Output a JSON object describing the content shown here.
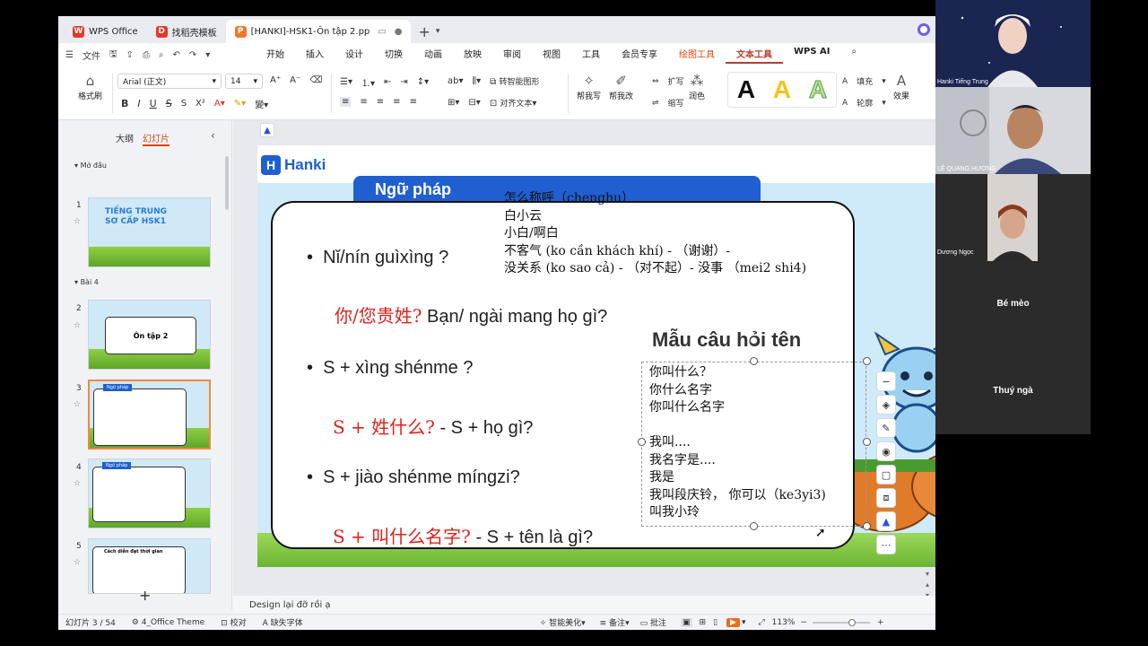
{
  "tabs": [
    {
      "label": "WPS Office",
      "icon": "wps-logo-icon",
      "color": "#e8362a"
    },
    {
      "label": "找稻壳模板",
      "icon": "docer-icon",
      "color": "#e8362a"
    },
    {
      "label": "[HANKI]-HSK1-Ôn tập 2.pp",
      "icon": "presentation-file-icon",
      "color": "#f0782a",
      "active": true
    }
  ],
  "menubar": {
    "file": "文件",
    "items": [
      "开始",
      "插入",
      "设计",
      "切换",
      "动画",
      "放映",
      "审阅",
      "视图",
      "工具",
      "会员专享",
      "绘图工具",
      "文本工具",
      "WPS AI"
    ]
  },
  "ribbon": {
    "format_painter": "格式刷",
    "font_name": "Arial (正文)",
    "font_size": "14",
    "smart_shape": "转智能图形",
    "align_text": "对齐文本",
    "help_write": "帮我写",
    "help_modify": "帮我改",
    "expand": "扩写",
    "shrink": "缩写",
    "polish": "润色",
    "fill": "填充",
    "outline": "轮廓",
    "effects": "效果",
    "wordart_glyph": "A"
  },
  "left_panel": {
    "tab_outline": "大纲",
    "tab_slides": "幻灯片",
    "section1": "Mở đầu",
    "section2": "Bài 4",
    "slide1_title": "TIẾNG TRUNG SƠ CẤP HSK1",
    "slide2_title": "Ôn tập 2",
    "slide3_title": "Ngữ pháp",
    "slide4_title": "Ngữ pháp",
    "slide5_title": "Cách diễn đạt thời gian",
    "numbers": [
      "1",
      "2",
      "3",
      "4",
      "5"
    ]
  },
  "slide": {
    "logo_text": "Hanki",
    "pill_title": "Ngữ pháp",
    "bullet": "•",
    "line1": "Nǐ/nín guìxìng ?",
    "line2_zh": "你/您贵姓?",
    "line2_vi": "Bạn/ ngài mang họ gì?",
    "line3": "S +  xìng shénme ?",
    "line4_zh": "S + 姓什么?",
    "line4_vi": "-  S + họ gì?",
    "line5": "S + jiào shénme míngzi?",
    "line6_zh": "S + 叫什么名字?",
    "line6_vi": "-  S + tên là gì?",
    "side_title": "Mẫu câu hỏi tên",
    "overlay_top": [
      "怎么称呼（chenghu）",
      "白小云",
      "小白/啊白",
      "不客气 (ko cần khách khí)  - （谢谢）-",
      "没关系 (ko sao cả) -  （对不起）- 没事 （mei2 shi4)"
    ],
    "overlay_box": [
      "你叫什么？",
      "你什么名字",
      "你叫什么名字",
      "",
      "我叫....",
      "我名字是....",
      "我是",
      "我叫段庆铃，  你可以（ke3yi3)",
      "叫我小玲"
    ]
  },
  "notes": "Design lại đỡ rồi ạ",
  "status": {
    "slide_no": "幻灯片 3 / 54",
    "theme": "4_Office Theme",
    "proof": "校对",
    "missing_font": "缺失字体",
    "beautify": "智能美化",
    "notes": "备注",
    "comments": "批注",
    "zoom": "113%"
  },
  "videos": [
    {
      "name": "Hanki Tiếng Trung",
      "bg": "#1d2a55"
    },
    {
      "name": "LÊ QUANG HƯƠNG",
      "bg": "#c8ced6"
    },
    {
      "name": "Dương Ngọc",
      "bg": "#2b2b2b"
    },
    {
      "name": "Bé mèo",
      "bg": "#2b2b2b"
    },
    {
      "name": "Thuý ngà",
      "bg": "#2b2b2b"
    }
  ]
}
